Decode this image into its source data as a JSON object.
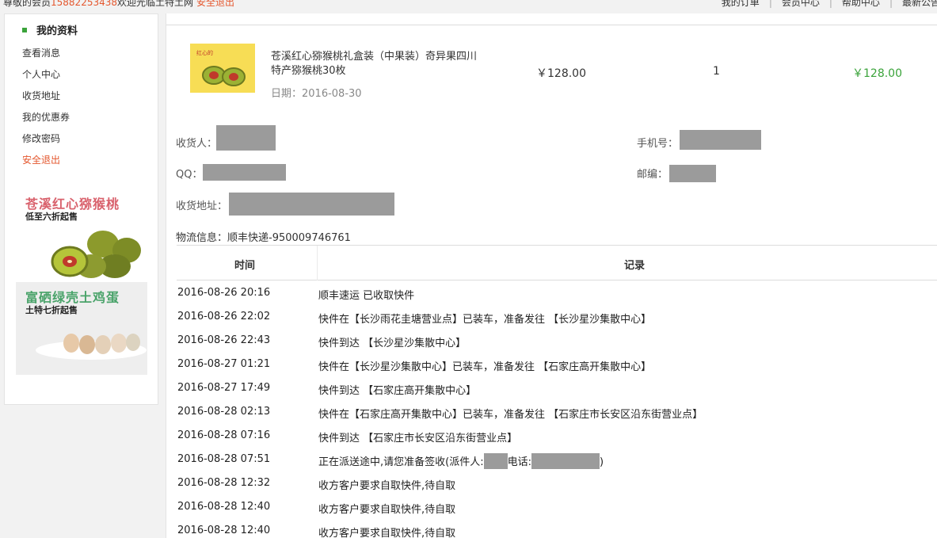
{
  "topbar": {
    "welcome_prefix": "尊敬的会员",
    "phone": "15882253438",
    "welcome_suffix": "欢迎光临土特土网",
    "logout": "安全退出",
    "links": [
      "我的订单",
      "会员中心",
      "帮助中心",
      "最新公告"
    ]
  },
  "sidebar": {
    "title": "我的资料",
    "items": [
      {
        "label": "查看消息"
      },
      {
        "label": "个人中心"
      },
      {
        "label": "收货地址"
      },
      {
        "label": "我的优惠券"
      },
      {
        "label": "修改密码"
      },
      {
        "label": "安全退出"
      }
    ],
    "promos": [
      {
        "title": "苍溪红心猕猴桃",
        "subtitle": "低至六折起售"
      },
      {
        "title": "富硒绿壳土鸡蛋",
        "subtitle": "土特七折起售"
      }
    ]
  },
  "order": {
    "product_image_text": "红心的",
    "product_name": "苍溪红心猕猴桃礼盒装（中果装）奇异果四川特产猕猴桃30枚",
    "date_label": "日期：2016-08-30",
    "price": "￥128.00",
    "quantity": "1",
    "total": "￥128.00"
  },
  "receiver": {
    "name_label": "收货人：",
    "phone_label": "手机号：",
    "qq_label": "QQ：",
    "zip_label": "邮编：",
    "address_label": "收货地址："
  },
  "logistics": {
    "info": "物流信息：顺丰快递-950009746761",
    "col_time": "时间",
    "col_record": "记录",
    "rows": [
      {
        "time": "2016-08-26 20:16",
        "record": "顺丰速运 已收取快件"
      },
      {
        "time": "2016-08-26 22:02",
        "record": "快件在【长沙雨花圭塘营业点】已装车，准备发往 【长沙星沙集散中心】"
      },
      {
        "time": "2016-08-26 22:43",
        "record": "快件到达 【长沙星沙集散中心】"
      },
      {
        "time": "2016-08-27 01:21",
        "record": "快件在【长沙星沙集散中心】已装车，准备发往 【石家庄高开集散中心】"
      },
      {
        "time": "2016-08-27 17:49",
        "record": "快件到达 【石家庄高开集散中心】"
      },
      {
        "time": "2016-08-28 02:13",
        "record": "快件在【石家庄高开集散中心】已装车，准备发往 【石家庄市长安区沿东街营业点】"
      },
      {
        "time": "2016-08-28 07:16",
        "record": "快件到达 【石家庄市长安区沿东街营业点】"
      },
      {
        "time": "2016-08-28 07:51",
        "record_prefix": "正在派送途中,请您准备签收(派件人:",
        "record_mid": "电话:",
        "record_suffix": ")"
      },
      {
        "time": "2016-08-28 12:32",
        "record": "收方客户要求自取快件,待自取"
      },
      {
        "time": "2016-08-28 12:40",
        "record": "收方客户要求自取快件,待自取"
      },
      {
        "time": "2016-08-28 12:40",
        "record": "收方客户要求自取快件,待自取"
      }
    ]
  },
  "colors": {
    "accent_green": "#3aa33a",
    "accent_orange": "#e4572e",
    "redaction": "#9b9b9b"
  }
}
